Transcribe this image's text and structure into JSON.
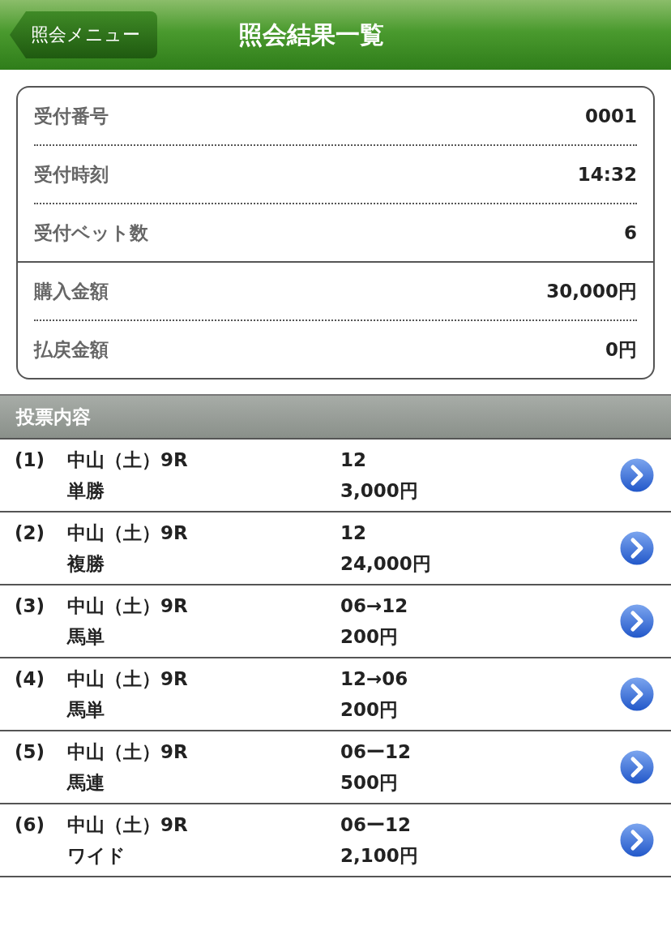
{
  "header": {
    "back_button": "照会メニュー",
    "title": "照会結果一覧"
  },
  "summary": {
    "groups": [
      [
        {
          "label": "受付番号",
          "value": "0001"
        },
        {
          "label": "受付時刻",
          "value": "14:32"
        },
        {
          "label": "受付ベット数",
          "value": "6"
        }
      ],
      [
        {
          "label": "購入金額",
          "value": "30,000円"
        },
        {
          "label": "払戻金額",
          "value": "0円"
        }
      ]
    ]
  },
  "section": {
    "title": "投票内容"
  },
  "bets": [
    {
      "number": "(1)",
      "race": "中山（土）9R",
      "type": "単勝",
      "combination": "12",
      "amount": "3,000円"
    },
    {
      "number": "(2)",
      "race": "中山（土）9R",
      "type": "複勝",
      "combination": "12",
      "amount": "24,000円"
    },
    {
      "number": "(3)",
      "race": "中山（土）9R",
      "type": "馬単",
      "combination": "06→12",
      "amount": "200円"
    },
    {
      "number": "(4)",
      "race": "中山（土）9R",
      "type": "馬単",
      "combination": "12→06",
      "amount": "200円"
    },
    {
      "number": "(5)",
      "race": "中山（土）9R",
      "type": "馬連",
      "combination": "06ー12",
      "amount": "500円"
    },
    {
      "number": "(6)",
      "race": "中山（土）9R",
      "type": "ワイド",
      "combination": "06ー12",
      "amount": "2,100円"
    }
  ]
}
